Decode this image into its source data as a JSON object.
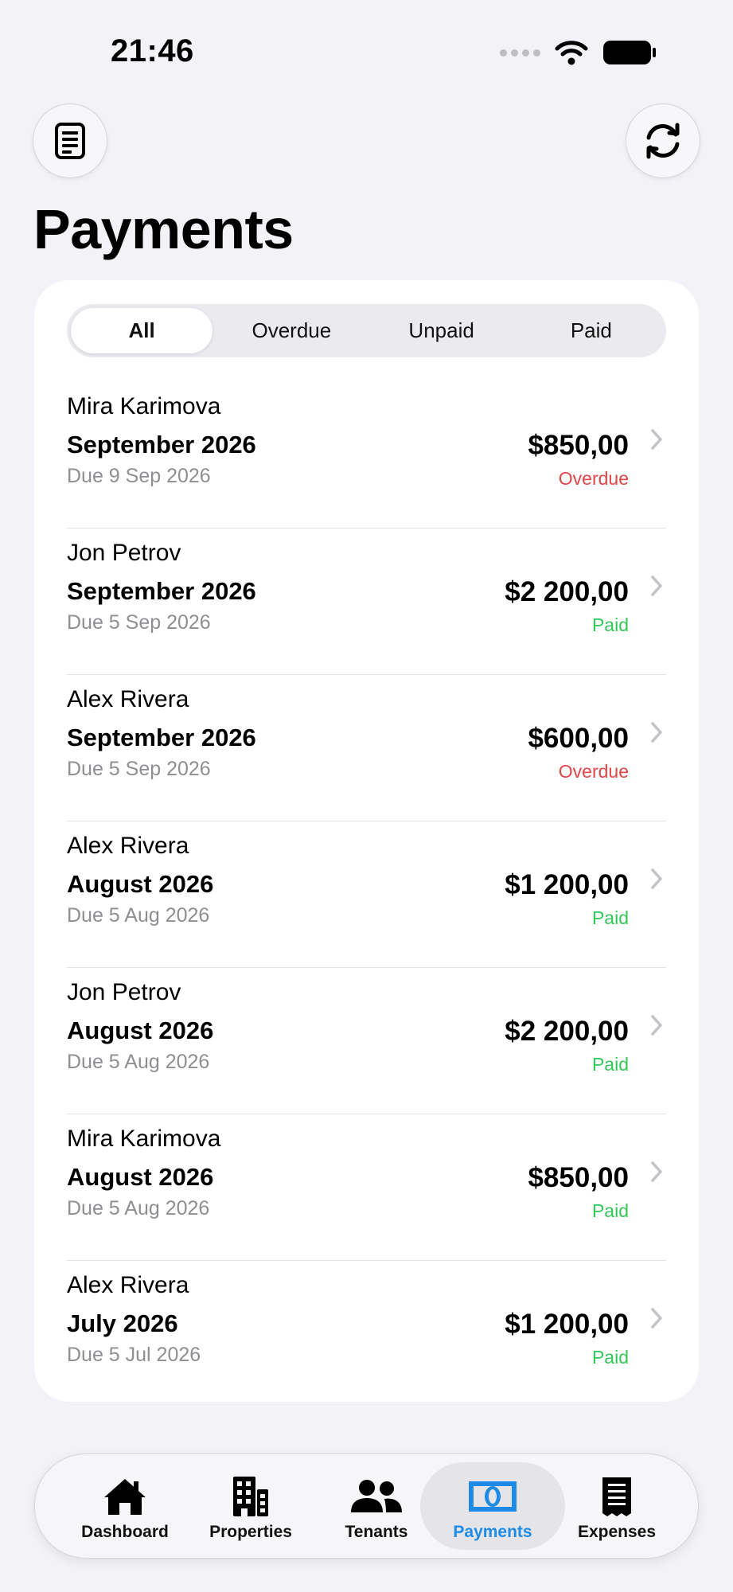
{
  "status_bar": {
    "time": "21:46"
  },
  "header": {
    "title": "Payments",
    "left_icon": "document-icon",
    "right_icon": "sync-icon"
  },
  "filters": {
    "options": [
      "All",
      "Overdue",
      "Unpaid",
      "Paid"
    ],
    "selected": "All"
  },
  "payments": [
    {
      "tenant": "Mira Karimova",
      "period": "September 2026",
      "due": "Due 9 Sep 2026",
      "amount": "$850,00",
      "status": "Overdue"
    },
    {
      "tenant": "Jon Petrov",
      "period": "September 2026",
      "due": "Due 5 Sep 2026",
      "amount": "$2 200,00",
      "status": "Paid"
    },
    {
      "tenant": "Alex Rivera",
      "period": "September 2026",
      "due": "Due 5 Sep 2026",
      "amount": "$600,00",
      "status": "Overdue"
    },
    {
      "tenant": "Alex Rivera",
      "period": "August 2026",
      "due": "Due 5 Aug 2026",
      "amount": "$1 200,00",
      "status": "Paid"
    },
    {
      "tenant": "Jon Petrov",
      "period": "August 2026",
      "due": "Due 5 Aug 2026",
      "amount": "$2 200,00",
      "status": "Paid"
    },
    {
      "tenant": "Mira Karimova",
      "period": "August 2026",
      "due": "Due 5 Aug 2026",
      "amount": "$850,00",
      "status": "Paid"
    },
    {
      "tenant": "Alex Rivera",
      "period": "July 2026",
      "due": "Due 5 Jul 2026",
      "amount": "$1 200,00",
      "status": "Paid"
    }
  ],
  "tabbar": {
    "items": [
      {
        "label": "Dashboard",
        "icon": "house-icon"
      },
      {
        "label": "Properties",
        "icon": "building-icon"
      },
      {
        "label": "Tenants",
        "icon": "people-icon"
      },
      {
        "label": "Payments",
        "icon": "banknote-icon"
      },
      {
        "label": "Expenses",
        "icon": "receipt-icon"
      }
    ],
    "active": "Payments"
  },
  "colors": {
    "accent": "#1E8BE6",
    "overdue": "#E0454A",
    "paid": "#34C759",
    "background": "#F2F2F7"
  }
}
